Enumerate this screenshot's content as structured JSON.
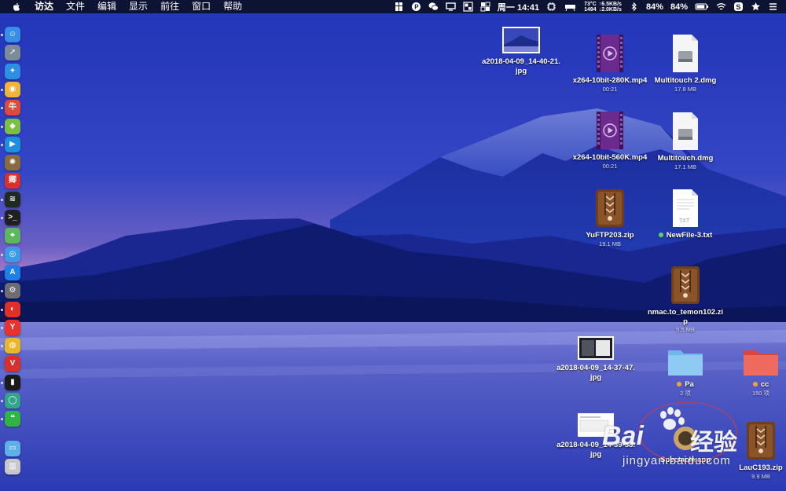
{
  "menubar": {
    "app_name": "访达",
    "items": [
      "文件",
      "编辑",
      "显示",
      "前往",
      "窗口",
      "帮助"
    ],
    "datetime": "周一 14:41",
    "temperature": "73°C",
    "net_up": "↑6.5KB/s",
    "fan": "1494",
    "net_down": "↓2.0KB/s",
    "battery_a": "84%",
    "battery_b": "84%"
  },
  "dock": {
    "items": [
      {
        "name": "finder",
        "color": "#3a8ee8",
        "glyph": "☺"
      },
      {
        "name": "launchpad",
        "color": "#7c8a9a",
        "glyph": "➚"
      },
      {
        "name": "safari",
        "color": "#2c8fe6",
        "glyph": "✦"
      },
      {
        "name": "preview",
        "color": "#f0b43c",
        "glyph": "◉"
      },
      {
        "name": "app-red",
        "color": "#e04a3a",
        "glyph": "牛"
      },
      {
        "name": "android",
        "color": "#7cc043",
        "glyph": "◆"
      },
      {
        "name": "screen-share",
        "color": "#1d8fe0",
        "glyph": "▶"
      },
      {
        "name": "system-utility",
        "color": "#8a6a40",
        "glyph": "✺"
      },
      {
        "name": "app-web",
        "color": "#d9302c",
        "glyph": "卿"
      },
      {
        "name": "activity-monitor",
        "color": "#1e2a22",
        "glyph": "≋"
      },
      {
        "name": "terminal",
        "color": "#202020",
        "glyph": ">_"
      },
      {
        "name": "maps",
        "color": "#5cb85c",
        "glyph": "⌖"
      },
      {
        "name": "siri",
        "color": "#3a9be8",
        "glyph": "◎"
      },
      {
        "name": "app-store",
        "color": "#1f7fe8",
        "glyph": "A"
      },
      {
        "name": "system-preferences",
        "color": "#6e6e72",
        "glyph": "⚙"
      },
      {
        "name": "netease-music",
        "color": "#e0302a",
        "glyph": "◐"
      },
      {
        "name": "yandex",
        "color": "#e8322a",
        "glyph": "Y"
      },
      {
        "name": "chrome",
        "color": "#e8b82a",
        "glyph": "◍"
      },
      {
        "name": "vivaldi",
        "color": "#d9302c",
        "glyph": "V"
      },
      {
        "name": "console",
        "color": "#1a1a1a",
        "glyph": "▮"
      },
      {
        "name": "app-green",
        "color": "#2fa58a",
        "glyph": "◯"
      },
      {
        "name": "wechat",
        "color": "#2fb544",
        "glyph": "❝"
      },
      {
        "name": "downloads-folder",
        "color": "#5fb0ea",
        "glyph": "▭"
      },
      {
        "name": "trash",
        "color": "#c8c8c8",
        "glyph": "▥"
      }
    ]
  },
  "desktop": {
    "icons": [
      {
        "id": "shot1",
        "label": "a2018-04-09_14-40-21.jpg",
        "sub": ""
      },
      {
        "id": "mp4a",
        "label": "x264-10bit-280K.mp4",
        "sub": "00:21"
      },
      {
        "id": "dmg1",
        "label": "Multitouch 2.dmg",
        "sub": "17.8 MB"
      },
      {
        "id": "mp4b",
        "label": "x264-10bit-560K.mp4",
        "sub": "00:21"
      },
      {
        "id": "dmg2",
        "label": "Multitouch.dmg",
        "sub": "17.1 MB"
      },
      {
        "id": "zip1",
        "label": "YuFTP203.zip",
        "sub": "19.1 MB"
      },
      {
        "id": "txt1",
        "label": "NewFile-3.txt",
        "sub": "",
        "tag_color": "#5ed35e"
      },
      {
        "id": "zip2",
        "label": "nmac.to_temon102.zip",
        "sub": "5.5 MB"
      },
      {
        "id": "shot2",
        "label": "a2018-04-09_14-37-47.jpg",
        "sub": ""
      },
      {
        "id": "folderPa",
        "label": "Pa",
        "sub": "2 项",
        "tag_color": "#f5a23c"
      },
      {
        "id": "folderCc",
        "label": "cc",
        "sub": "150 项",
        "tag_color": "#f5a23c"
      },
      {
        "id": "shot3",
        "label": "a2018-04-09_14-39-58.jpg",
        "sub": ""
      },
      {
        "id": "app1",
        "label": "Spectacle.app",
        "sub": ""
      },
      {
        "id": "zip3",
        "label": "LauC193.zip",
        "sub": "9.9 MB"
      }
    ]
  },
  "watermark": {
    "brand": "Bai",
    "brand2": "经验",
    "url": "jingyan.baidu.com"
  }
}
